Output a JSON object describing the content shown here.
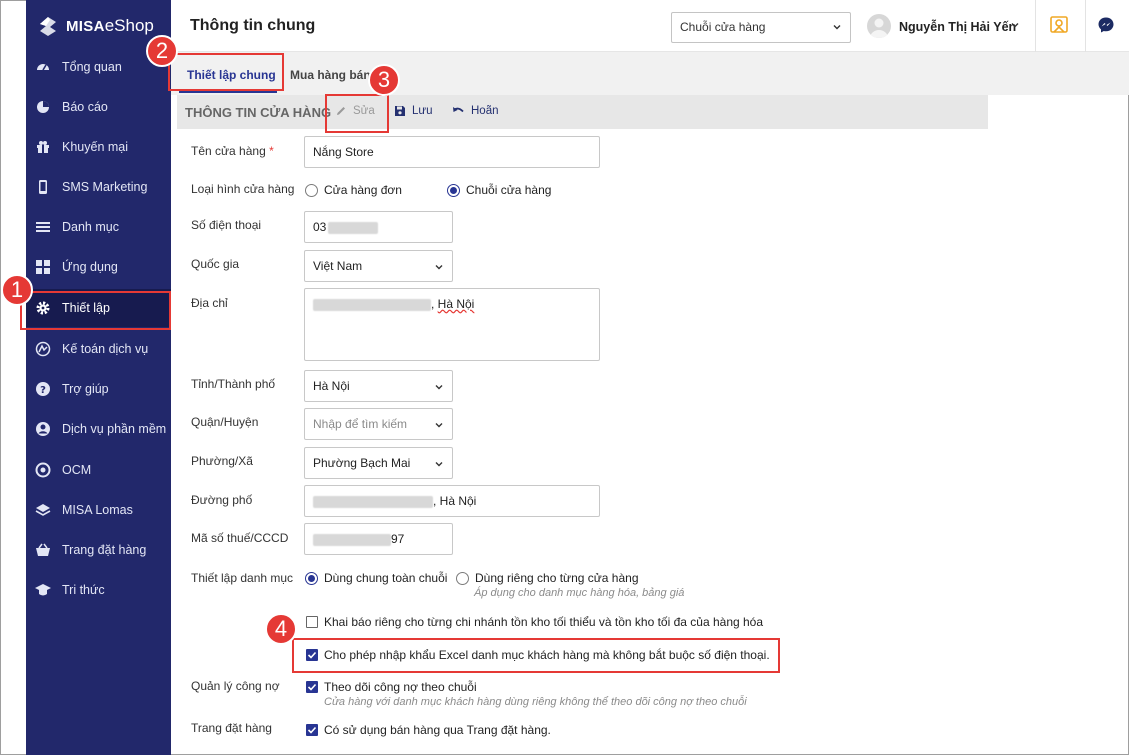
{
  "app": {
    "brand_bold": "MISA",
    "brand_light": "eShop"
  },
  "sidebar": {
    "items": [
      {
        "label": "Tổng quan",
        "icon": "dashboard-icon"
      },
      {
        "label": "Báo cáo",
        "icon": "pie-chart-icon"
      },
      {
        "label": "Khuyến mại",
        "icon": "gift-icon"
      },
      {
        "label": "SMS Marketing",
        "icon": "phone-icon"
      },
      {
        "label": "Danh mục",
        "icon": "list-icon"
      },
      {
        "label": "Ứng dụng",
        "icon": "apps-icon"
      },
      {
        "label": "Thiết lập",
        "icon": "gear-icon"
      },
      {
        "label": "Kế toán dịch vụ",
        "icon": "accounting-icon"
      },
      {
        "label": "Trợ giúp",
        "icon": "help-icon"
      },
      {
        "label": "Dịch vụ phần mềm",
        "icon": "user-circle-icon"
      },
      {
        "label": "OCM",
        "icon": "ocm-icon"
      },
      {
        "label": "MISA Lomas",
        "icon": "layers-icon"
      },
      {
        "label": "Trang đặt hàng",
        "icon": "basket-icon"
      },
      {
        "label": "Tri thức",
        "icon": "graduation-cap-icon"
      }
    ]
  },
  "header": {
    "title": "Thông tin chung",
    "store_select": "Chuỗi cửa hàng",
    "user_name": "Nguyễn Thị Hải Yến"
  },
  "tabs": [
    {
      "label": "Thiết lập chung"
    },
    {
      "label": "Mua hàng bán h"
    }
  ],
  "toolbar": {
    "section_title": "THÔNG TIN CỬA HÀNG",
    "edit": "Sửa",
    "save": "Lưu",
    "undo": "Hoãn"
  },
  "form": {
    "store_name_label": "Tên cửa hàng",
    "store_name_required": "*",
    "store_name_value": "Nắng Store",
    "store_type_label": "Loại hình cửa hàng",
    "store_type_single": "Cửa hàng đơn",
    "store_type_chain": "Chuỗi cửa hàng",
    "phone_label": "Số điện thoại",
    "phone_value": "03",
    "country_label": "Quốc gia",
    "country_value": "Việt Nam",
    "address_label": "Địa chỉ",
    "address_comma": ", ",
    "address_city": "Hà Nội",
    "province_label": "Tỉnh/Thành phố",
    "province_value": "Hà Nội",
    "district_label": "Quận/Huyện",
    "district_placeholder": "Nhập để tìm kiếm",
    "ward_label": "Phường/Xã",
    "ward_value": "Phường Bạch Mai",
    "street_label": "Đường phố",
    "street_value": ", Hà Nội",
    "tax_label": "Mã số thuế/CCCD",
    "tax_value": "97",
    "catalog_label": "Thiết lập danh mục",
    "catalog_shared": "Dùng chung toàn chuỗi",
    "catalog_separate": "Dùng riêng cho từng cửa hàng",
    "catalog_hint": "Áp dụng cho danh mục hàng hóa, bảng giá",
    "branch_stock_check": "Khai báo riêng cho từng chi nhánh tồn kho tối thiểu và tồn kho tối đa của hàng hóa",
    "excel_import_check": "Cho phép nhập khẩu Excel danh mục khách hàng mà không bắt buộc số điện thoại.",
    "debt_label": "Quản lý công nợ",
    "debt_check": "Theo dõi công nợ theo chuỗi",
    "debt_hint": "Cửa hàng với danh mục khách hàng dùng riêng không thể theo dõi công nợ theo chuỗi",
    "order_page_label": "Trang đặt hàng",
    "order_page_check": "Có sử dụng bán hàng qua Trang đặt hàng."
  },
  "annotations": {
    "step1": "1",
    "step2": "2",
    "step3": "3",
    "step4": "4"
  },
  "colors": {
    "sidebar": "#22286b",
    "accent": "#283593",
    "highlight": "#e53935"
  }
}
